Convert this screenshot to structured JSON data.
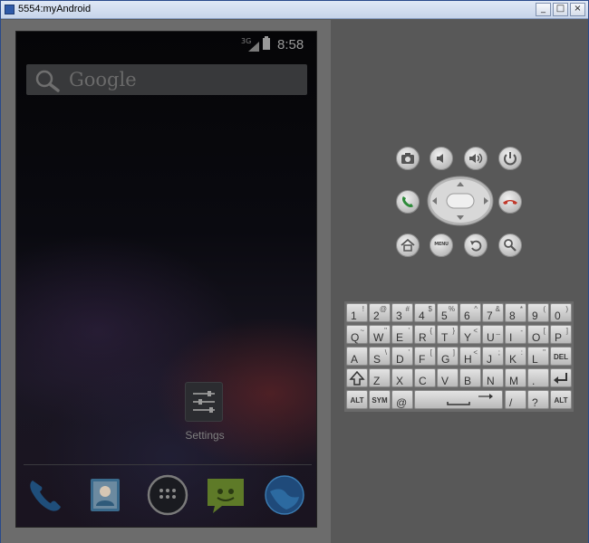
{
  "window": {
    "title": "5554:myAndroid",
    "minimize": "_",
    "maximize": "□",
    "close": "×"
  },
  "status_bar": {
    "network": "3G",
    "time": "8:58"
  },
  "search_bar": {
    "text": "Google"
  },
  "home": {
    "app_label": "Settings"
  },
  "dock": {
    "items": [
      "phone-icon",
      "contacts-icon",
      "app-drawer-icon",
      "messaging-icon",
      "browser-icon"
    ]
  },
  "hardware": {
    "menu_label": "MENU"
  },
  "keyboard": {
    "row1": [
      {
        "main": "1",
        "sub": "!"
      },
      {
        "main": "2",
        "sub": "@"
      },
      {
        "main": "3",
        "sub": "#"
      },
      {
        "main": "4",
        "sub": "$"
      },
      {
        "main": "5",
        "sub": "%"
      },
      {
        "main": "6",
        "sub": "^"
      },
      {
        "main": "7",
        "sub": "&"
      },
      {
        "main": "8",
        "sub": "*"
      },
      {
        "main": "9",
        "sub": "("
      },
      {
        "main": "0",
        "sub": ")"
      }
    ],
    "row2": [
      {
        "main": "Q",
        "sub": "~"
      },
      {
        "main": "W",
        "sub": "\""
      },
      {
        "main": "E",
        "sub": "'"
      },
      {
        "main": "R",
        "sub": "{"
      },
      {
        "main": "T",
        "sub": "}"
      },
      {
        "main": "Y",
        "sub": "<"
      },
      {
        "main": "U",
        "sub": "_"
      },
      {
        "main": "I",
        "sub": "-"
      },
      {
        "main": "O",
        "sub": "["
      },
      {
        "main": "P",
        "sub": "]"
      }
    ],
    "row3": [
      {
        "main": "A",
        "sub": ""
      },
      {
        "main": "S",
        "sub": "\\"
      },
      {
        "main": "D",
        "sub": "'"
      },
      {
        "main": "F",
        "sub": "["
      },
      {
        "main": "G",
        "sub": "]"
      },
      {
        "main": "H",
        "sub": "<"
      },
      {
        "main": "J",
        "sub": ";"
      },
      {
        "main": "K",
        "sub": ":"
      },
      {
        "main": "L",
        "sub": "\""
      },
      {
        "main": "DEL",
        "sub": ""
      }
    ],
    "row4": [
      {
        "main": "Z",
        "sub": ""
      },
      {
        "main": "X",
        "sub": ""
      },
      {
        "main": "C",
        "sub": ""
      },
      {
        "main": "V",
        "sub": ""
      },
      {
        "main": "B",
        "sub": ""
      },
      {
        "main": "N",
        "sub": ""
      },
      {
        "main": "M",
        "sub": ""
      },
      {
        "main": ".",
        "sub": ""
      }
    ],
    "row5": {
      "alt_left": "ALT",
      "sym": "SYM",
      "at": "@",
      "slash": "/",
      "question": "?",
      "alt_right": "ALT"
    }
  },
  "colors": {
    "window_frame": "#2a4a8a",
    "emulator_bg": "#585858",
    "screen_bg": "#000000",
    "call_green": "#2e8b3a",
    "end_red": "#c0392b"
  }
}
